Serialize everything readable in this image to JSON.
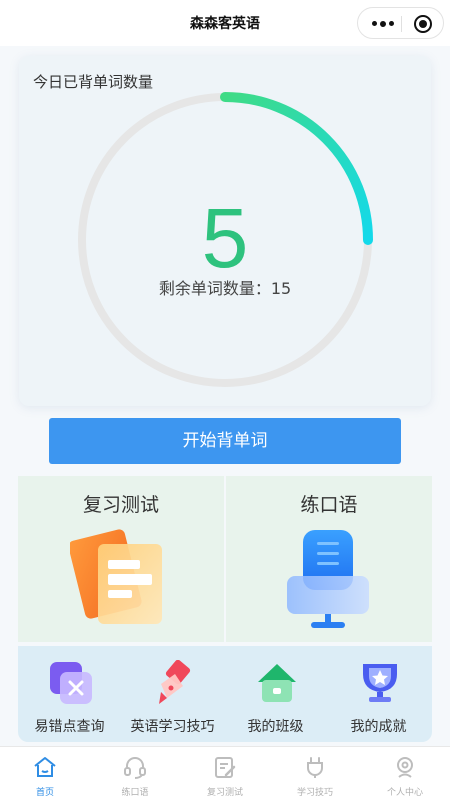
{
  "app": {
    "title": "森森客英语"
  },
  "progress": {
    "label": "今日已背单词数量",
    "learned": 5,
    "total": 20,
    "learned_text": "5",
    "remaining_text": "剩余单词数量：15",
    "ring_colors": [
      "#3fdb86",
      "#13d9ea"
    ],
    "track_color": "#e6e6e6",
    "number_color": "#2ec27e"
  },
  "start_button": {
    "label": "开始背单词",
    "color": "#3d96f0"
  },
  "features": [
    {
      "label": "复习测试",
      "icon": "cards-icon"
    },
    {
      "label": "练口语",
      "icon": "microphone-icon"
    }
  ],
  "quick_links": [
    {
      "label": "易错点查询",
      "icon": "error-query-icon"
    },
    {
      "label": "英语学习技巧",
      "icon": "pen-icon"
    },
    {
      "label": "我的班级",
      "icon": "class-house-icon"
    },
    {
      "label": "我的成就",
      "icon": "trophy-icon"
    }
  ],
  "tabs": [
    {
      "label": "首页",
      "icon": "home-icon",
      "active": true
    },
    {
      "label": "练口语",
      "icon": "headset-icon",
      "active": false
    },
    {
      "label": "复习测试",
      "icon": "edit-note-icon",
      "active": false
    },
    {
      "label": "学习技巧",
      "icon": "plug-icon",
      "active": false
    },
    {
      "label": "个人中心",
      "icon": "user-icon",
      "active": false
    }
  ],
  "accent_color": "#2f8de4"
}
